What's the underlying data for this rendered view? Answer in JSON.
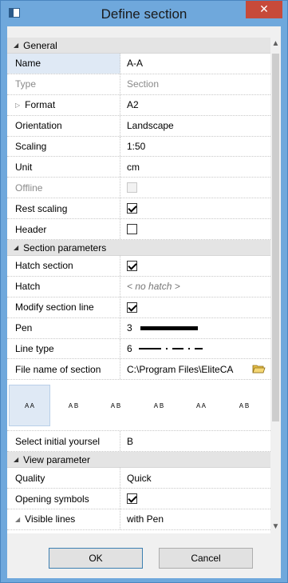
{
  "window": {
    "title": "Define section",
    "close_glyph": "✕"
  },
  "sections": {
    "general": "General",
    "section_parameters": "Section parameters",
    "view_parameter": "View parameter"
  },
  "rows": {
    "name": {
      "label": "Name",
      "value": "A-A"
    },
    "type": {
      "label": "Type",
      "value": "Section"
    },
    "format": {
      "label": "Format",
      "value": "A2"
    },
    "orientation": {
      "label": "Orientation",
      "value": "Landscape"
    },
    "scaling": {
      "label": "Scaling",
      "value": "1:50"
    },
    "unit": {
      "label": "Unit",
      "value": "cm"
    },
    "offline": {
      "label": "Offline",
      "checked": false,
      "disabled": true
    },
    "rest_scaling": {
      "label": "Rest scaling",
      "checked": true
    },
    "header": {
      "label": "Header",
      "checked": false
    },
    "hatch_section": {
      "label": "Hatch section",
      "checked": true
    },
    "hatch": {
      "label": "Hatch",
      "value": "< no hatch >"
    },
    "modify_section_line": {
      "label": "Modify section line",
      "checked": true
    },
    "pen": {
      "label": "Pen",
      "value": "3"
    },
    "line_type": {
      "label": "Line type",
      "value": "6"
    },
    "file_name": {
      "label": "File name of section",
      "value": "C:\\Program Files\\EliteCA"
    },
    "select_initial": {
      "label": "Select initial yoursel",
      "value": "B"
    },
    "quality": {
      "label": "Quality",
      "value": "Quick"
    },
    "opening_symbols": {
      "label": "Opening symbols",
      "checked": true
    },
    "visible_lines": {
      "label": "Visible lines",
      "value": "with Pen"
    }
  },
  "symbols": [
    {
      "label": "A  A",
      "selected": true
    },
    {
      "label": "A  B",
      "selected": false
    },
    {
      "label": "A  B",
      "selected": false
    },
    {
      "label": "A  B",
      "selected": false
    },
    {
      "label": "A  A",
      "selected": false
    },
    {
      "label": "A  B",
      "selected": false
    }
  ],
  "buttons": {
    "ok": "OK",
    "cancel": "Cancel"
  }
}
